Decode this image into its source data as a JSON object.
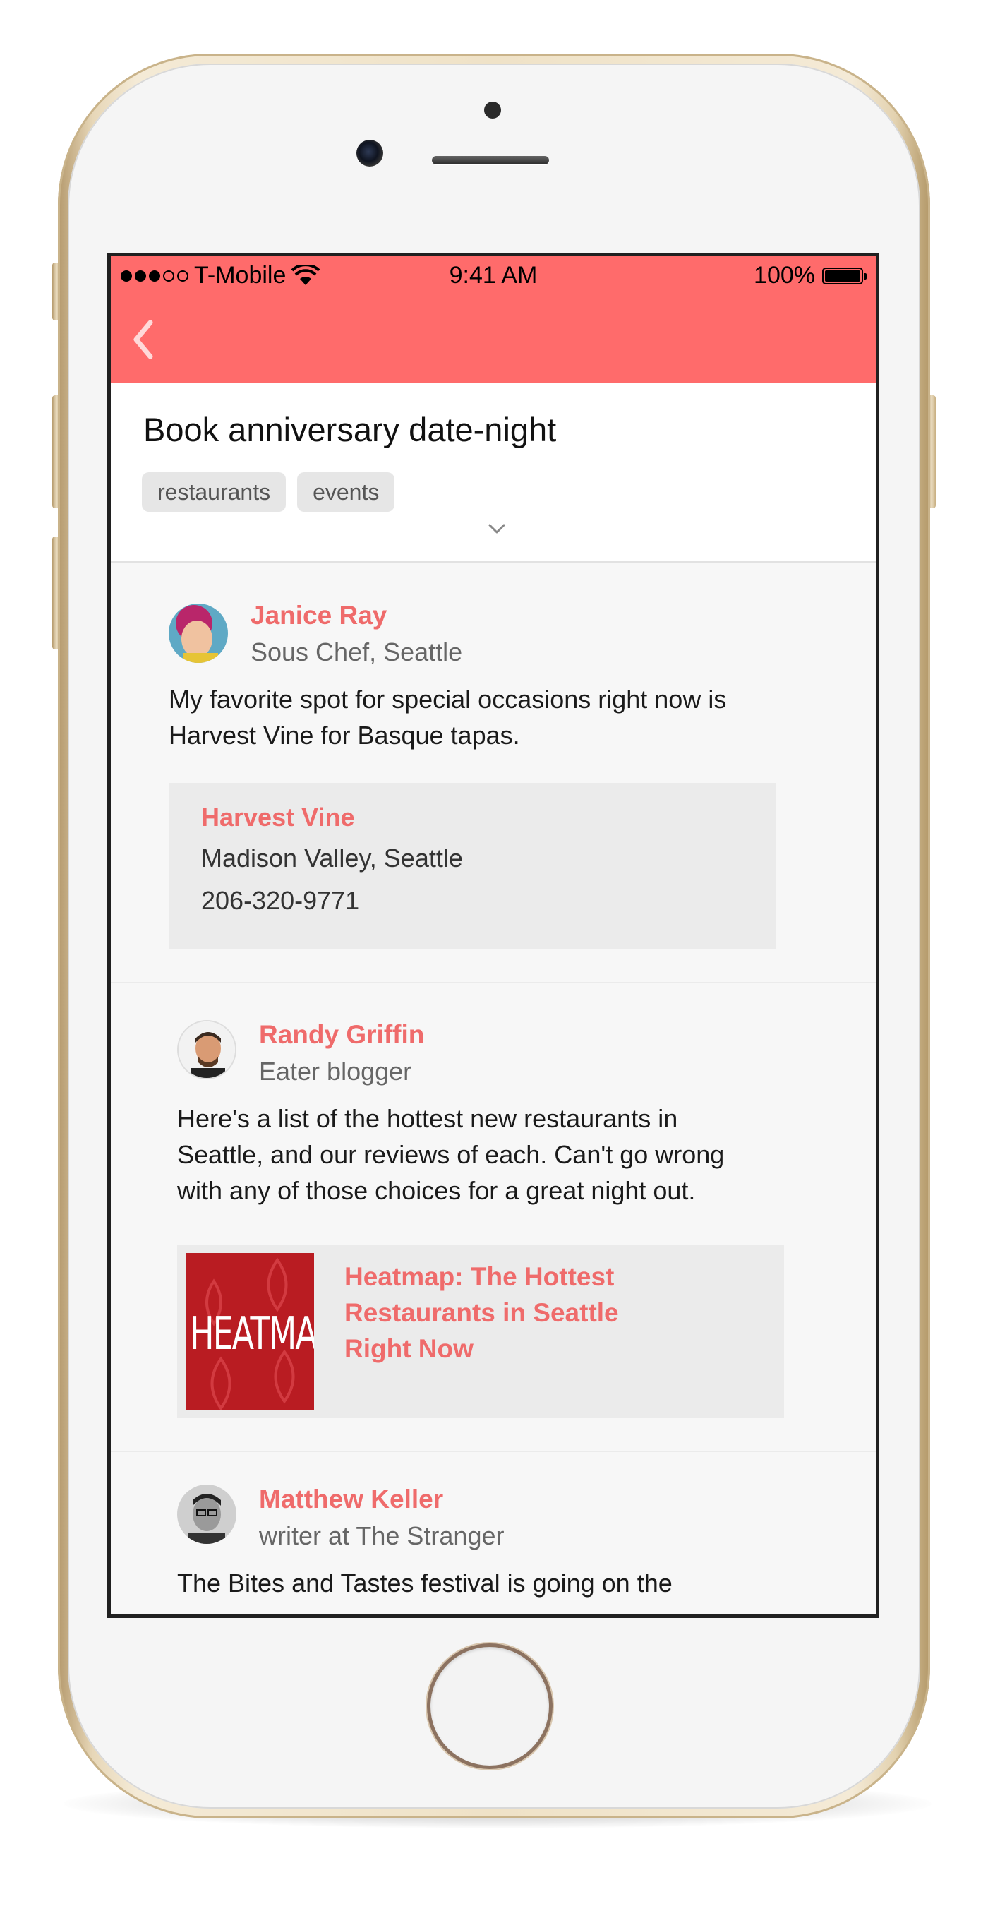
{
  "status_bar": {
    "carrier": "T-Mobile",
    "time": "9:41 AM",
    "battery": "100%"
  },
  "header": {
    "title": "Book anniversary date-night",
    "tags": [
      "restaurants",
      "events"
    ]
  },
  "cards": [
    {
      "author": "Janice Ray",
      "role": "Sous Chef, Seattle",
      "text_lines": [
        "My favorite spot for special occasions right now is",
        "Harvest Vine for Basque tapas."
      ],
      "place": {
        "name": "Harvest Vine",
        "location": "Madison Valley, Seattle",
        "phone": "206-320-9771"
      }
    },
    {
      "author": "Randy Griffin",
      "role": "Eater blogger",
      "text_lines": [
        "Here's a list of the hottest new restaurants in",
        "Seattle, and our reviews of each. Can't go wrong",
        "with any of those choices for a great night out."
      ],
      "link": {
        "thumb_text": "HEATMAP",
        "title_lines": [
          "Heatmap: The Hottest",
          "Restaurants in Seattle",
          "Right Now"
        ]
      }
    },
    {
      "author": "Matthew Keller",
      "role": "writer at The Stranger",
      "text_lines": [
        "The Bites and Tastes festival is going on the"
      ]
    }
  ],
  "colors": {
    "accent": "#ff6b6b",
    "link_text": "#ef6b6b"
  }
}
